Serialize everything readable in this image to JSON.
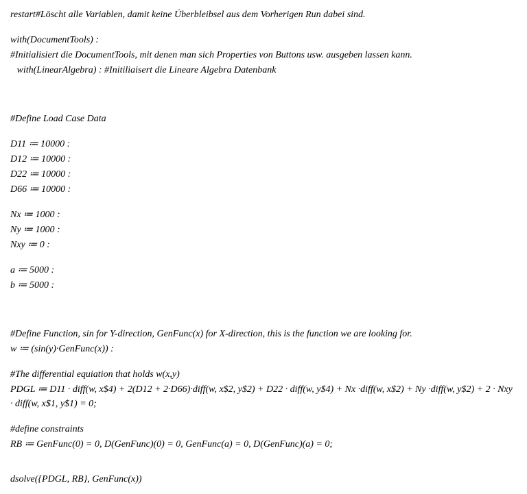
{
  "lines": {
    "l1": "restart#Löscht alle Variablen, damit keine Überbleibsel aus dem Vorherigen Run dabei sind.",
    "l2": "with(DocumentTools) :",
    "l3": "#Initialisiert die DocumentTools, mit denen man sich Properties von Buttons usw. ausgeben lassen kann.",
    "l4": " with(LinearAlgebra) : #Initiliaisert die Lineare Algebra Datenbank",
    "l5": "#Define Load Case Data",
    "l6": "D11 ≔ 10000 :",
    "l7": "D12 ≔ 10000 :",
    "l8": "D22 ≔ 10000 :",
    "l9": "D66 ≔ 10000 :",
    "l10": "Nx ≔ 1000 :",
    "l11": "Ny ≔ 1000 :",
    "l12": "Nxy ≔ 0 :",
    "l13": "a ≔ 5000 :",
    "l14": "b ≔ 5000 :",
    "l15": "#Define Function, sin for Y-direction, GenFunc(x) for X-direction, this is the function we are looking for.",
    "l16": "w ≔ (sin(y)·GenFunc(x)) :",
    "l17": "#The differential equiation that holds w(x,y)",
    "l18": "PDGL ≔ D11 · diff(w, x$4) + 2(D12 + 2·D66)·diff(w, x$2, y$2) + D22 · diff(w, y$4) + Nx ·diff(w, x$2) + Ny ·diff(w, y$2) + 2 · Nxy · diff(w, x$1, y$1) = 0;",
    "l19": "#define constraints",
    "l20": "RB ≔ GenFunc(0) = 0, D(GenFunc)(0) = 0, GenFunc(a) = 0, D(GenFunc)(a) = 0;",
    "l21": "dsolve({PDGL, RB}, GenFunc(x))"
  }
}
